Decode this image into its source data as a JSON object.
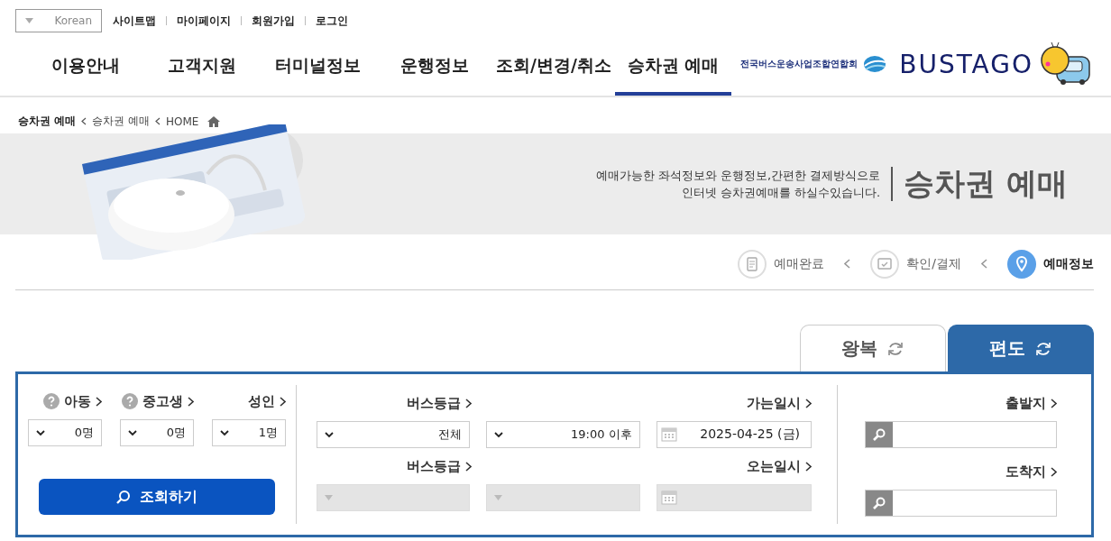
{
  "top_links": [
    "사이트맵",
    "마이페이지",
    "회원가입",
    "로그인"
  ],
  "language_select": {
    "value": "Korean"
  },
  "logo": {
    "brand": "BUSTAGO",
    "org": "전국버스운송사업조합연합회"
  },
  "nav": [
    {
      "label": "이용안내",
      "selected": false
    },
    {
      "label": "고객지원",
      "selected": false
    },
    {
      "label": "터미널정보",
      "selected": false
    },
    {
      "label": "운행정보",
      "selected": false
    },
    {
      "label": "조회/변경/취소",
      "selected": false
    },
    {
      "label": "승차권 예매",
      "selected": true
    }
  ],
  "breadcrumb": [
    "승차권 예매",
    "승차권 예매",
    "HOME"
  ],
  "banner": {
    "title": "승차권 예매",
    "description": [
      "예매가능한 좌석정보와 운행정보,간편한 결제방식으로",
      "인터넷 승차권예매를 하실수있습니다."
    ]
  },
  "steps": [
    {
      "label": "예매완료",
      "selected": false
    },
    {
      "label": "확인/결제",
      "selected": false
    },
    {
      "label": "예매정보",
      "selected": true
    }
  ],
  "trip_tabs": [
    {
      "label": "왕복",
      "selected": false
    },
    {
      "label": "편도",
      "selected": true
    }
  ],
  "form": {
    "places": [
      {
        "label": "출발지"
      },
      {
        "label": "도착지"
      }
    ],
    "schedule": [
      {
        "label": "가는일시",
        "date": "2025-04-25 (금)",
        "time": "19:00 이후",
        "grade_label": "버스등급",
        "grade": "전체",
        "disabled": false
      },
      {
        "label": "오는일시",
        "grade_label": "버스등급",
        "disabled": true
      }
    ],
    "passengers": [
      {
        "label": "아동",
        "value": "0명",
        "help": true
      },
      {
        "label": "중고생",
        "value": "0명",
        "help": true
      },
      {
        "label": "성인",
        "value": "1명",
        "help": false
      }
    ],
    "search_button": "조회하기"
  }
}
